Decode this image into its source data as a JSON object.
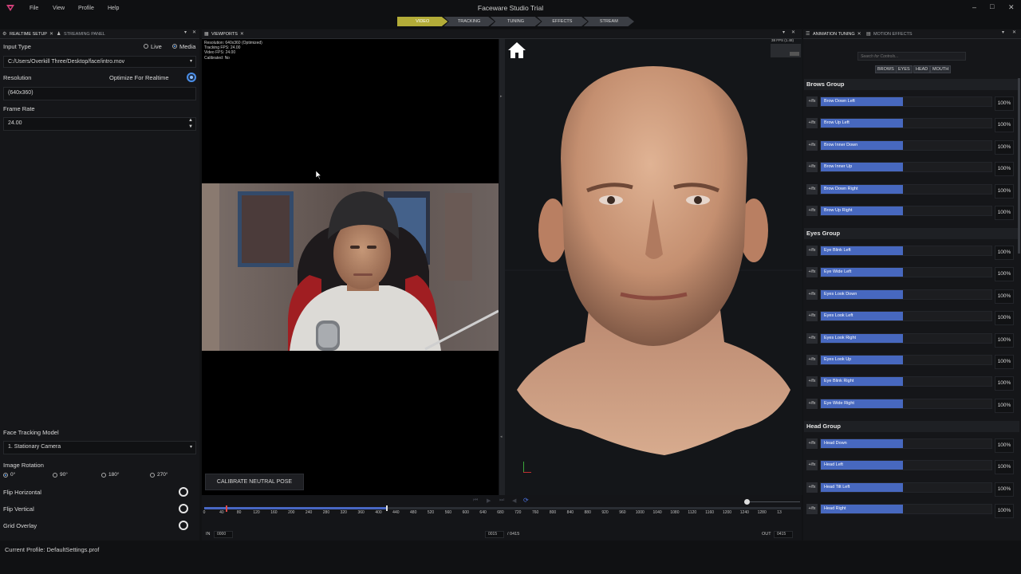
{
  "app": {
    "title": "Faceware Studio Trial",
    "menu": [
      "File",
      "View",
      "Profile",
      "Help"
    ],
    "accent": "#b3ac38",
    "bar_color": "#4768bf"
  },
  "stages": [
    "VIDEO",
    "TRACKING",
    "TUNING",
    "EFFECTS",
    "STREAM"
  ],
  "left_panel": {
    "tabs": [
      "REALTIME SETUP",
      "STREAMING PANEL"
    ],
    "input_type_label": "Input Type",
    "input_options": [
      "Live",
      "Media"
    ],
    "input_selected": "Media",
    "file_path": "C:/Users/Overkill Three/Desktop/face/intro.mov",
    "resolution_label": "Resolution",
    "optimize_label": "Optimize For Realtime",
    "resolution_value": "(640x360)",
    "frame_rate_label": "Frame Rate",
    "frame_rate_value": "24.00",
    "tracking_model_label": "Face Tracking Model",
    "tracking_model_value": "1. Stationary Camera",
    "rotation_label": "Image Rotation",
    "rotation_options": [
      "0°",
      "90°",
      "180°",
      "270°"
    ],
    "rotation_selected": "0°",
    "flip_h_label": "Flip Horizontal",
    "flip_v_label": "Flip Vertical",
    "grid_label": "Grid Overlay"
  },
  "viewport": {
    "tab": "VIEWPORTS",
    "stats": [
      "Resolution: 640x360 (Optimized)",
      "Tracking FPS: 24.00",
      "Video FPS: 24.00",
      "Calibrated: No"
    ],
    "calibrate_label": "CALIBRATE NEUTRAL POSE",
    "fps_readout": "38 FPS (1.48)"
  },
  "timeline": {
    "ticks": [
      "0",
      "40",
      "80",
      "120",
      "160",
      "200",
      "240",
      "280",
      "320",
      "360",
      "400",
      "440",
      "480",
      "520",
      "560",
      "600",
      "640",
      "680",
      "720",
      "760",
      "800",
      "840",
      "880",
      "920",
      "960",
      "1000",
      "1040",
      "1080",
      "1120",
      "1160",
      "1200",
      "1240",
      "1280",
      "13"
    ],
    "in_label": "IN",
    "in_value": "0000",
    "current_frame": "0015",
    "total_frames": "/ 0415",
    "out_label": "OUT",
    "out_value": "0415",
    "playhead_fraction": 0.036,
    "range_end_fraction": 0.305
  },
  "right_panel": {
    "tabs": [
      "ANIMATION TUNING",
      "MOTION EFFECTS"
    ],
    "search_placeholder": "Search for Controls...",
    "filters": [
      "BROWS",
      "EYES",
      "HEAD",
      "MOUTH"
    ],
    "groups": [
      {
        "name": "Brows Group",
        "controls": [
          "Brow Down Left",
          "Brow Up Left",
          "Brow Inner Down",
          "Brow Inner Up",
          "Brow Down Right",
          "Brow Up Right"
        ]
      },
      {
        "name": "Eyes Group",
        "controls": [
          "Eye Blink Left",
          "Eye Wide Left",
          "Eyes Look Down",
          "Eyes Look Left",
          "Eyes Look Right",
          "Eyes Look Up",
          "Eye Blink Right",
          "Eye Wide Right"
        ]
      },
      {
        "name": "Head Group",
        "controls": [
          "Head Down",
          "Head Left",
          "Head Tilt Left",
          "Head Right"
        ]
      }
    ],
    "fx_label": "+/fx",
    "value_label": "100%"
  },
  "status": {
    "profile": "Current Profile: DefaultSettings.prof"
  }
}
